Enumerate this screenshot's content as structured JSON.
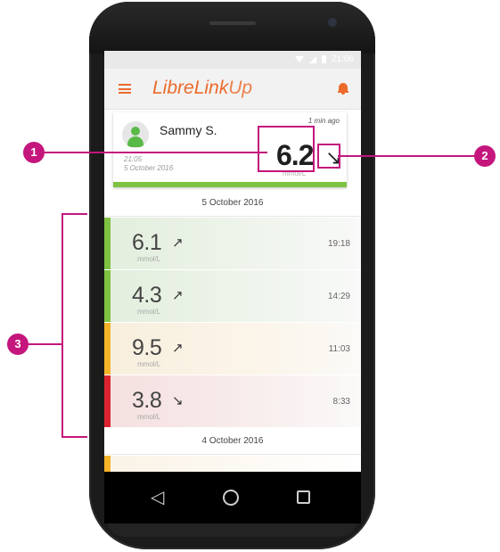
{
  "colors": {
    "brand": "#ec6a2c",
    "annotation": "#c4167c",
    "in_range": "#7fc243",
    "high": "#f4b329",
    "low": "#d9232e"
  },
  "status_bar": {
    "time": "21:06"
  },
  "app": {
    "title": "LibreLink",
    "title_suffix": "Up",
    "menu_icon": "hamburger-icon",
    "alert_icon": "bell-icon"
  },
  "current": {
    "name": "Sammy S.",
    "ago": "1 min ago",
    "time": "21:05",
    "date": "5 October 2016",
    "value": "6.2",
    "unit": "mmol/L",
    "trend": "↘"
  },
  "days": [
    {
      "date": "5 October 2016",
      "readings": [
        {
          "value": "6.1",
          "trend": "↗",
          "unit": "mmol/L",
          "time": "19:18",
          "range": "in-range"
        },
        {
          "value": "4.3",
          "trend": "↗",
          "unit": "mmol/L",
          "time": "14:29",
          "range": "in-range"
        },
        {
          "value": "9.5",
          "trend": "↗",
          "unit": "mmol/L",
          "time": "11:03",
          "range": "high"
        },
        {
          "value": "3.8",
          "trend": "↘",
          "unit": "mmol/L",
          "time": "8:33",
          "range": "low"
        }
      ]
    },
    {
      "date": "4 October 2016",
      "readings": []
    }
  ],
  "nav": {
    "back_icon": "back-icon",
    "home_icon": "home-icon",
    "recents_icon": "recents-icon"
  },
  "annotations": {
    "callout_1": "1",
    "callout_2": "2",
    "callout_3": "3"
  }
}
